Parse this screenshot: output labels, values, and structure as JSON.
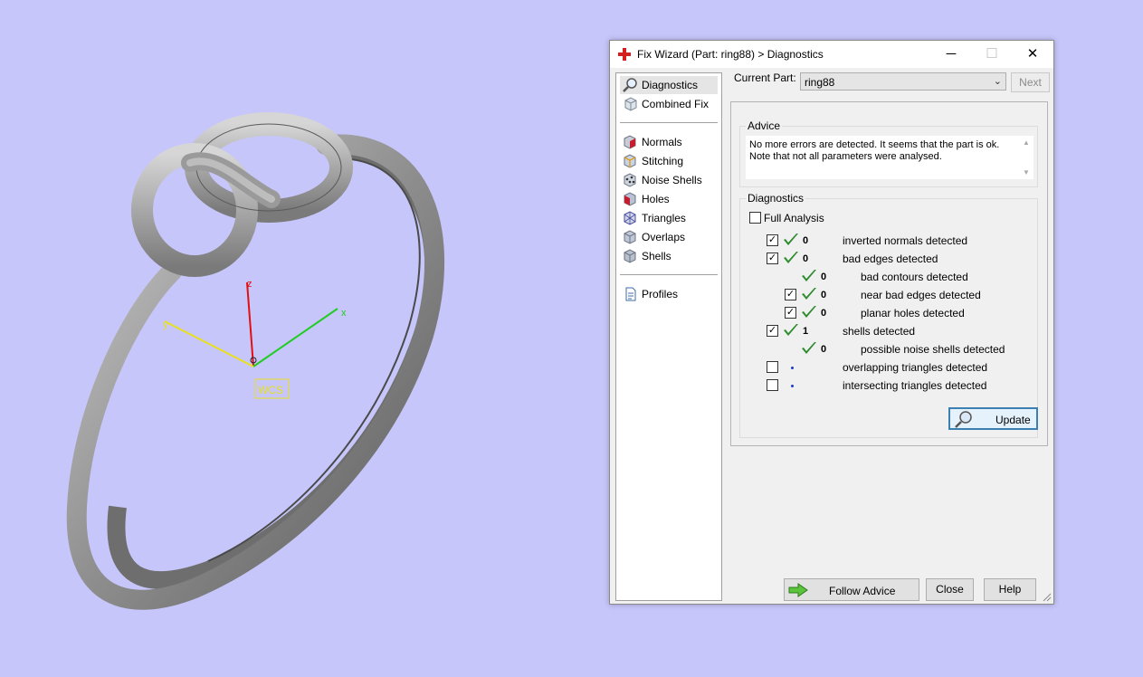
{
  "viewport": {
    "axis_labels": {
      "z": "z",
      "x": "x",
      "y": "y"
    },
    "wcs_label": "WCS"
  },
  "window": {
    "title": "Fix Wizard (Part: ring88) > Diagnostics",
    "controls": {
      "minimize": "─",
      "maximize": "☐",
      "close": "✕"
    }
  },
  "nav": {
    "top": [
      {
        "label": "Diagnostics",
        "icon": "magnifier-icon",
        "selected": true
      },
      {
        "label": "Combined Fix",
        "icon": "cube-icon"
      }
    ],
    "middle": [
      {
        "label": "Normals",
        "icon": "normals-cube-icon"
      },
      {
        "label": "Stitching",
        "icon": "stitching-cube-icon"
      },
      {
        "label": "Noise Shells",
        "icon": "noise-shells-icon"
      },
      {
        "label": "Holes",
        "icon": "holes-cube-icon"
      },
      {
        "label": "Triangles",
        "icon": "triangles-cube-icon"
      },
      {
        "label": "Overlaps",
        "icon": "overlaps-cube-icon"
      },
      {
        "label": "Shells",
        "icon": "shells-cube-icon"
      }
    ],
    "bottom": [
      {
        "label": "Profiles",
        "icon": "document-icon"
      }
    ]
  },
  "current_part": {
    "label": "Current Part:",
    "value": "ring88",
    "next_label": "Next"
  },
  "advice": {
    "title": "Advice",
    "text": "No more errors are detected. It seems that the part is ok. Note that not all parameters were analysed."
  },
  "diagnostics": {
    "title": "Diagnostics",
    "full_analysis_label": "Full Analysis",
    "rows": [
      {
        "checkbox": true,
        "checked": true,
        "status": "ok",
        "count": "0",
        "label": "inverted normals detected",
        "indent": 0
      },
      {
        "checkbox": true,
        "checked": true,
        "status": "ok",
        "count": "0",
        "label": "bad edges detected",
        "indent": 0
      },
      {
        "checkbox": false,
        "checked": false,
        "status": "ok",
        "count": "0",
        "label": "bad contours detected",
        "indent": 1
      },
      {
        "checkbox": true,
        "checked": true,
        "status": "ok",
        "count": "0",
        "label": "near bad edges detected",
        "indent": 1
      },
      {
        "checkbox": true,
        "checked": true,
        "status": "ok",
        "count": "0",
        "label": "planar holes detected",
        "indent": 1
      },
      {
        "checkbox": true,
        "checked": true,
        "status": "ok",
        "count": "1",
        "label": "shells detected",
        "indent": 0
      },
      {
        "checkbox": false,
        "checked": false,
        "status": "ok",
        "count": "0",
        "label": "possible noise shells detected",
        "indent": 1
      },
      {
        "checkbox": true,
        "checked": false,
        "status": "none",
        "count": "",
        "label": "overlapping triangles detected",
        "indent": 0
      },
      {
        "checkbox": true,
        "checked": false,
        "status": "none",
        "count": "",
        "label": "intersecting triangles detected",
        "indent": 0
      }
    ],
    "update_label": "Update"
  },
  "footer": {
    "follow_advice_label": "Follow Advice",
    "close_label": "Close",
    "help_label": "Help"
  },
  "colors": {
    "background": "#c6c6fa",
    "ring": "#8c8c8c",
    "axis_z": "#e01010",
    "axis_x": "#22cc22",
    "axis_y": "#e8e020",
    "check": "#2e8b2e",
    "accent": "#3c7fb1"
  }
}
